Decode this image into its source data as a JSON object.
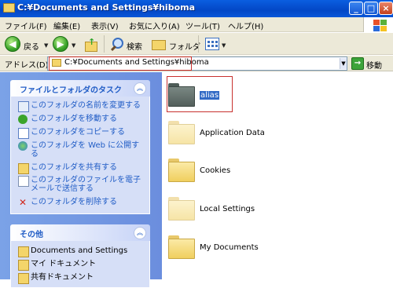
{
  "window": {
    "title": "C:¥Documents and Settings¥hiboma"
  },
  "menu": [
    "ファイル(F)",
    "編集(E)",
    "表示(V)",
    "お気に入り(A)",
    "ツール(T)",
    "ヘルプ(H)"
  ],
  "toolbar": {
    "back": "戻る",
    "search": "検索",
    "folders": "フォルダ"
  },
  "address": {
    "label": "アドレス(D)",
    "path": "C:¥Documents and Settings¥hiboma",
    "go": "移動"
  },
  "tasks_panel": {
    "title": "ファイルとフォルダのタスク",
    "items": [
      "このフォルダの名前を変更する",
      "このフォルダを移動する",
      "このフォルダをコピーする",
      "このフォルダを Web に公開する",
      "このフォルダを共有する",
      "このフォルダのファイルを電子メールで送信する",
      "このフォルダを削除する"
    ]
  },
  "other_panel": {
    "title": "その他",
    "items": [
      "Documents and Settings",
      "マイ ドキュメント",
      "共有ドキュメント"
    ]
  },
  "folders": [
    {
      "name": "alias",
      "selected": true
    },
    {
      "name": "Application Data",
      "selected": false
    },
    {
      "name": "Cookies",
      "selected": false
    },
    {
      "name": "Local Settings",
      "selected": false
    },
    {
      "name": "My Documents",
      "selected": false
    }
  ],
  "colors": {
    "titlebar": "#0a5ee0",
    "task_link": "#215dc6",
    "highlight": "#c8312e"
  }
}
